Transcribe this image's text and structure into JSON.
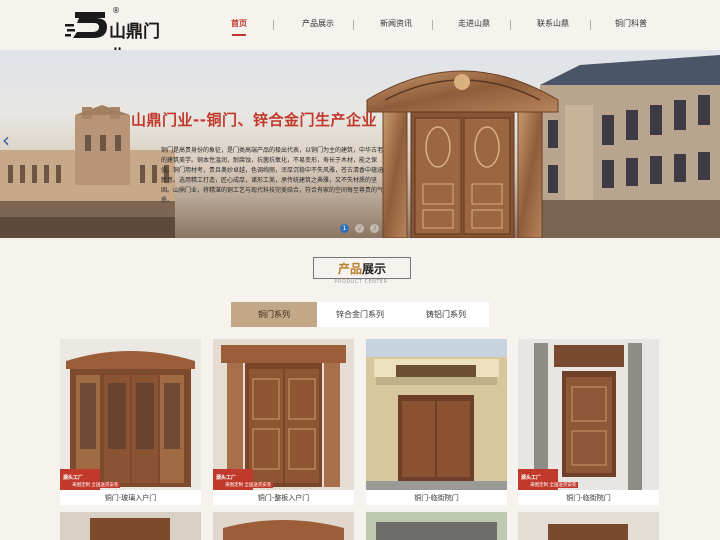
{
  "brand": {
    "name": "山鼎门业",
    "reg_mark": "®"
  },
  "nav": {
    "items": [
      {
        "label": "首页"
      },
      {
        "label": "产品展示"
      },
      {
        "label": "新闻资讯"
      },
      {
        "label": "走进山鼎"
      },
      {
        "label": "联系山鼎"
      },
      {
        "label": "铜门科普"
      }
    ],
    "active_index": 0
  },
  "banner": {
    "title": "山鼎门业--铜门、锌合金门生产企业",
    "description": "铜门是高贵身份的象征，是门类高端产品的极出代表，以铜门为主的建筑，中华古老的建筑美学。铜本性温润，耐腐蚀，抗菌抗氧化，不易变形，寿长于木材，能之保值。铜门用材考，贵且奥妙卓越，色调绚丽，浑厚沉稳中不失风雅，苍古清香中蕴涵新意。选用精工打造，匠心成厚，诸形工美，承传统建筑之典雅，又不失材质的坚固。山鼎门业，将精湛的铜工艺与现代科技完美结合，符合有家的空间每至尊贵的气质。",
    "dots": [
      "1",
      "2",
      "3"
    ],
    "active_dot": 0
  },
  "products": {
    "title_part1": "产品",
    "title_part2": "展示",
    "subtitle": "PRODUCT CENTER",
    "tabs": [
      {
        "label": "铜门系列"
      },
      {
        "label": "锌合金门系列"
      },
      {
        "label": "铸铝门系列"
      }
    ],
    "active_tab": 0,
    "items": [
      {
        "caption": "铜门-玻璃入户门",
        "badge": "源头工厂",
        "promo": "来图定制 全国送货安装"
      },
      {
        "caption": "铜门-整板入户门",
        "badge": "源头工厂",
        "promo": "来图定制 全国送货安装"
      },
      {
        "caption": "铜门-临街院门",
        "badge": "源头工厂",
        "promo": "来图定制 全国送货安装"
      },
      {
        "caption": "铜门-临街院门",
        "badge": "源头工厂",
        "promo": "来图定制 全国送货安装"
      }
    ]
  },
  "colors": {
    "accent_red": "#c0392b",
    "gold": "#b9802f",
    "tab_active": "#c2a788",
    "background": "#f6f2ee",
    "dot_active": "#2f6fc0"
  }
}
